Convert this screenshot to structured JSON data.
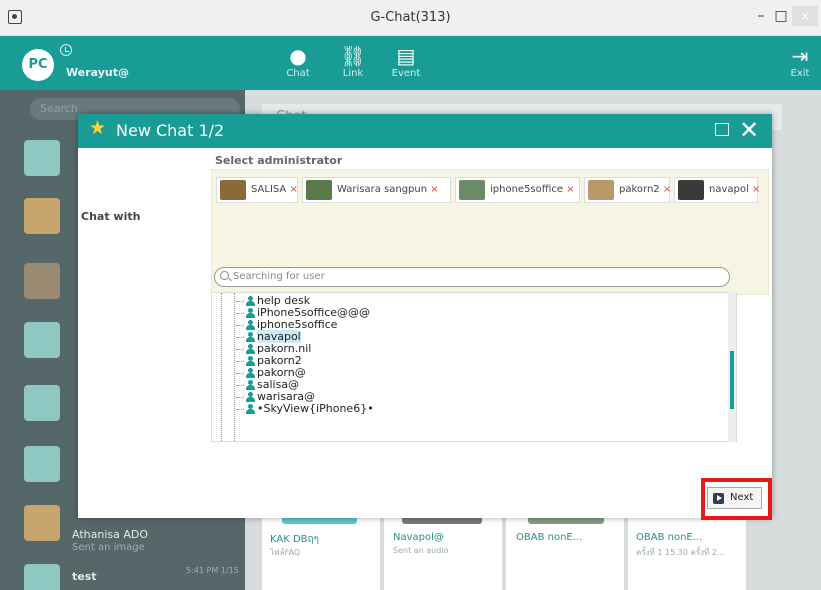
{
  "window": {
    "title": "G-Chat(313)",
    "minimize": "–",
    "maximize": "□",
    "close": "×"
  },
  "header": {
    "avatar_initials": "PC",
    "username": "Werayut@",
    "buttons": {
      "chat": "Chat",
      "link": "Link",
      "event": "Event",
      "exit": "Exit"
    }
  },
  "sidebar": {
    "search_placeholder": "Search",
    "items": [
      {
        "name": "Athanisa ADO",
        "sub": "Sent an image"
      },
      {
        "name": "test",
        "time": "5:41 PM 1/15"
      }
    ]
  },
  "main": {
    "chat_tab": "Chat",
    "cards": [
      {
        "name": "KAK DBฤๆ",
        "sub": "ไฟล์FAQ"
      },
      {
        "name": "Navapol@",
        "sub": "Sent an audio"
      },
      {
        "name": "OBAB nonE...",
        "sub": ""
      },
      {
        "name": "OBAB nonE...",
        "sub": "ครั้งที่ 1 15.30 ครั้งที่ 2..."
      }
    ]
  },
  "modal": {
    "title": "New Chat 1/2",
    "select_admin_label": "Select administrator",
    "chat_with_label": "Chat with",
    "chips": [
      {
        "label": "SALISA",
        "remove": "×",
        "color": "#8a6a3a"
      },
      {
        "label": "Warisara sangpun",
        "remove": "×",
        "color": "#5a7a4a"
      },
      {
        "label": "iphone5soffice",
        "remove": "×",
        "color": "#6a8a6a"
      },
      {
        "label": "pakorn2",
        "remove": "×",
        "color": "#b89a6a"
      },
      {
        "label": "navapol",
        "remove": "×",
        "color": "#3a3a3a"
      }
    ],
    "search_placeholder": "Searching for user",
    "tree_items": [
      "help desk",
      "iPhone5soffice@@@",
      "iphone5soffice",
      "navapol",
      "pakorn.nil",
      "pakorn2",
      "pakorn@",
      "salisa@",
      "warisara@",
      "•SkyView{iPhone6}•"
    ],
    "selected_item": "navapol",
    "next_label": "Next"
  },
  "colors": {
    "accent": "#1a9c96",
    "highlight": "#e31b1b",
    "star": "#ffd23a"
  }
}
